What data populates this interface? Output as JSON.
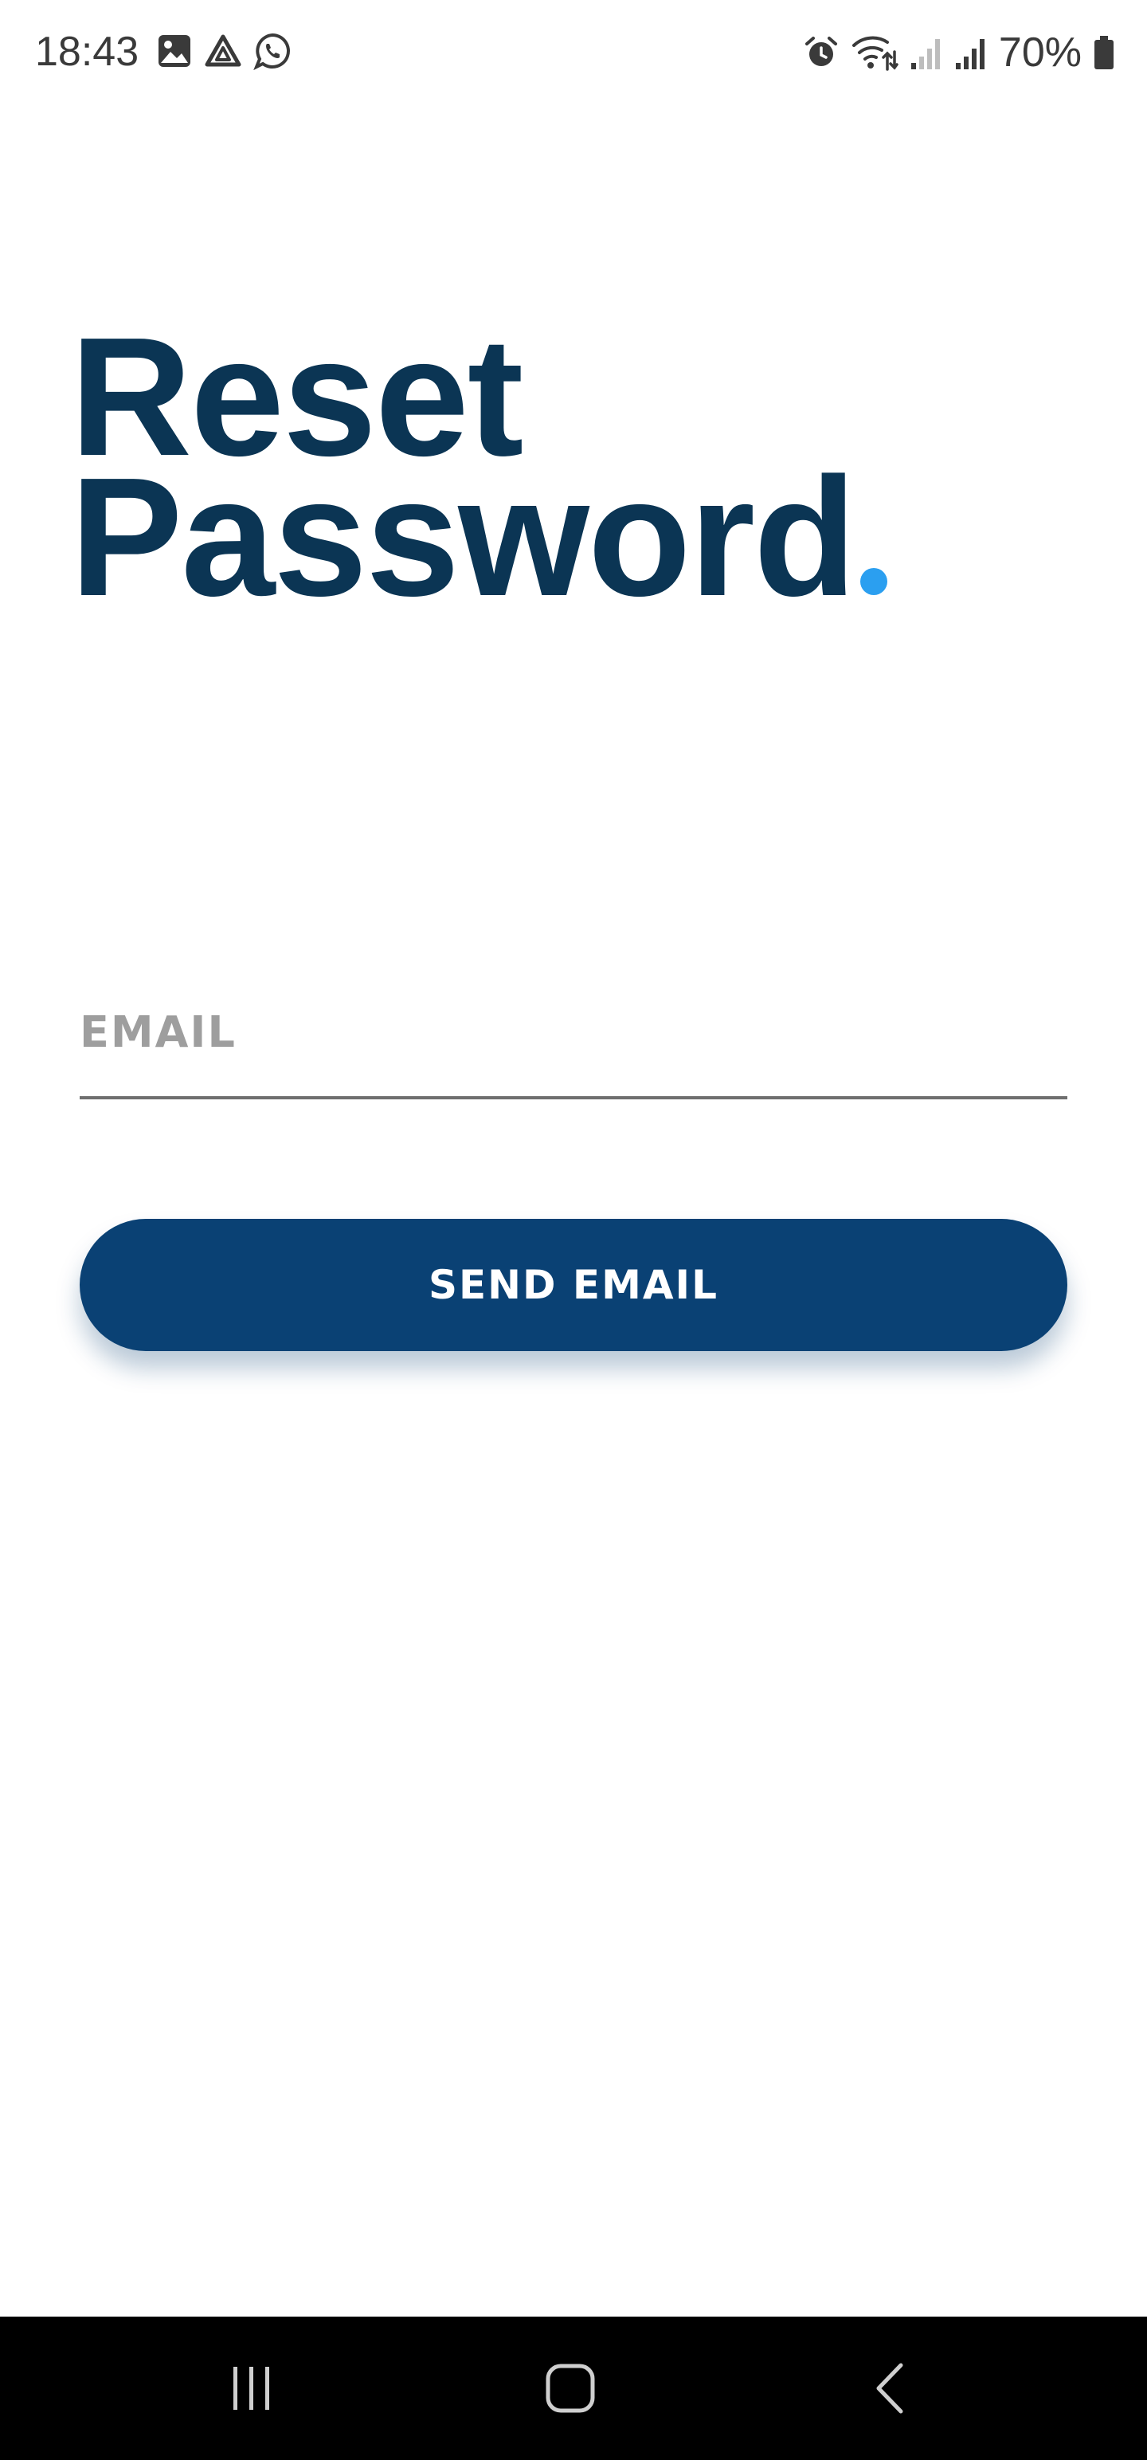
{
  "status_bar": {
    "time": "18:43",
    "left_icons": [
      "gallery-icon",
      "drive-icon",
      "whatsapp-icon"
    ],
    "right_icons": [
      "alarm-icon",
      "wifi-icon",
      "signal-weak-icon",
      "signal-icon",
      "battery-icon"
    ],
    "battery_percent": "70%"
  },
  "header": {
    "title_line1": "Reset",
    "title_line2": "Password",
    "title_color": "#0b3554",
    "accent_dot_color": "#2b9ff0"
  },
  "form": {
    "email_placeholder": "EMAIL",
    "email_value": "",
    "send_button_label": "SEND EMAIL",
    "button_color": "#0a4174"
  },
  "nav_bar": {
    "buttons": [
      "recents-icon",
      "home-icon",
      "back-icon"
    ]
  }
}
